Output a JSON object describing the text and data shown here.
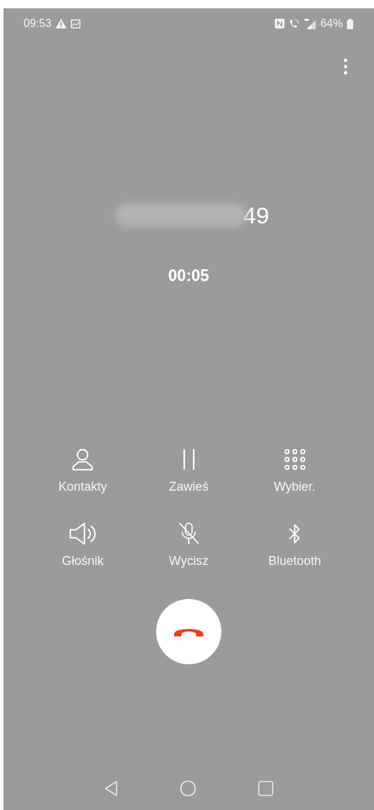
{
  "status_bar": {
    "time": "09:53",
    "battery": "64%"
  },
  "call": {
    "number_visible": "49",
    "timer": "00:05"
  },
  "actions": [
    {
      "kind": "contacts",
      "label": "Kontakty"
    },
    {
      "kind": "hold",
      "label": "Zawieś"
    },
    {
      "kind": "dialpad",
      "label": "Wybier."
    },
    {
      "kind": "speaker",
      "label": "Głośnik"
    },
    {
      "kind": "mute",
      "label": "Wycisz"
    },
    {
      "kind": "bluetooth",
      "label": "Bluetooth"
    }
  ]
}
